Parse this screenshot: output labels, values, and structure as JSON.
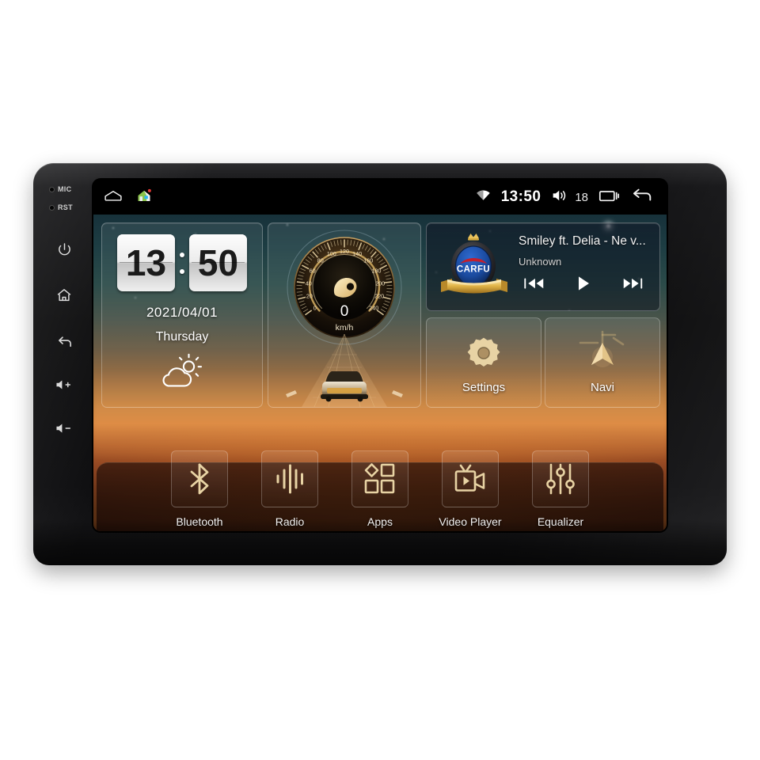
{
  "device": {
    "bezel_keys": [
      {
        "name": "mic-pinhole",
        "label": "MIC"
      },
      {
        "name": "reset-pinhole",
        "label": "RST"
      },
      {
        "name": "power-key",
        "label": "Power"
      },
      {
        "name": "home-key",
        "label": "Home"
      },
      {
        "name": "back-key",
        "label": "Back"
      },
      {
        "name": "volume-up-key",
        "label": "Volume Up"
      },
      {
        "name": "volume-down-key",
        "label": "Volume Down"
      }
    ]
  },
  "statusbar": {
    "left_icons": [
      {
        "name": "home-outline-icon",
        "label": "Home"
      },
      {
        "name": "house-app-icon",
        "label": "App"
      }
    ],
    "wifi_icon": "wifi-icon",
    "clock": "13:50",
    "volume_icon": "volume-icon",
    "volume_level": "18",
    "recents_icon": "recents-icon",
    "back_icon": "back-arrow-icon"
  },
  "clock_widget": {
    "hours": "13",
    "minutes": "50",
    "date": "2021/04/01",
    "weekday": "Thursday",
    "weather_icon": "sun-behind-cloud-icon"
  },
  "speed_widget": {
    "value": "0",
    "unit": "km/h",
    "ticks": [
      "0",
      "20",
      "40",
      "60",
      "80",
      "100",
      "120",
      "140",
      "160",
      "180",
      "200",
      "220",
      "240"
    ],
    "min": 0,
    "max": 240,
    "needle_icon": "gauge-needle-icon",
    "car_icon": "car-on-road-icon"
  },
  "media_widget": {
    "logo": {
      "name": "carfu-badge-icon",
      "text": "CARFU",
      "crown": "crown-icon"
    },
    "title": "Smiley ft. Delia - Ne v...",
    "artist": "Unknown",
    "controls": [
      {
        "name": "previous-track-button",
        "label": "Previous"
      },
      {
        "name": "play-button",
        "label": "Play"
      },
      {
        "name": "next-track-button",
        "label": "Next"
      }
    ]
  },
  "tiles": [
    {
      "name": "tile-settings",
      "label": "Settings",
      "icon": "gear-icon"
    },
    {
      "name": "tile-navi",
      "label": "Navi",
      "icon": "navigation-arrow-icon"
    }
  ],
  "dock": [
    {
      "name": "dock-item-bluetooth",
      "label": "Bluetooth",
      "icon": "bluetooth-icon"
    },
    {
      "name": "dock-item-radio",
      "label": "Radio",
      "icon": "radio-waveform-icon"
    },
    {
      "name": "dock-item-apps",
      "label": "Apps",
      "icon": "apps-grid-icon"
    },
    {
      "name": "dock-item-video-player",
      "label": "Video Player",
      "icon": "video-camera-icon"
    },
    {
      "name": "dock-item-equalizer",
      "label": "Equalizer",
      "icon": "equalizer-sliders-icon"
    }
  ],
  "colors": {
    "gold": "#e8d3a4",
    "status_text": "#ffffff",
    "badge_blue": "#16418c",
    "badge_red": "#c01f2e",
    "ribbon_gold": "#e8b949"
  }
}
